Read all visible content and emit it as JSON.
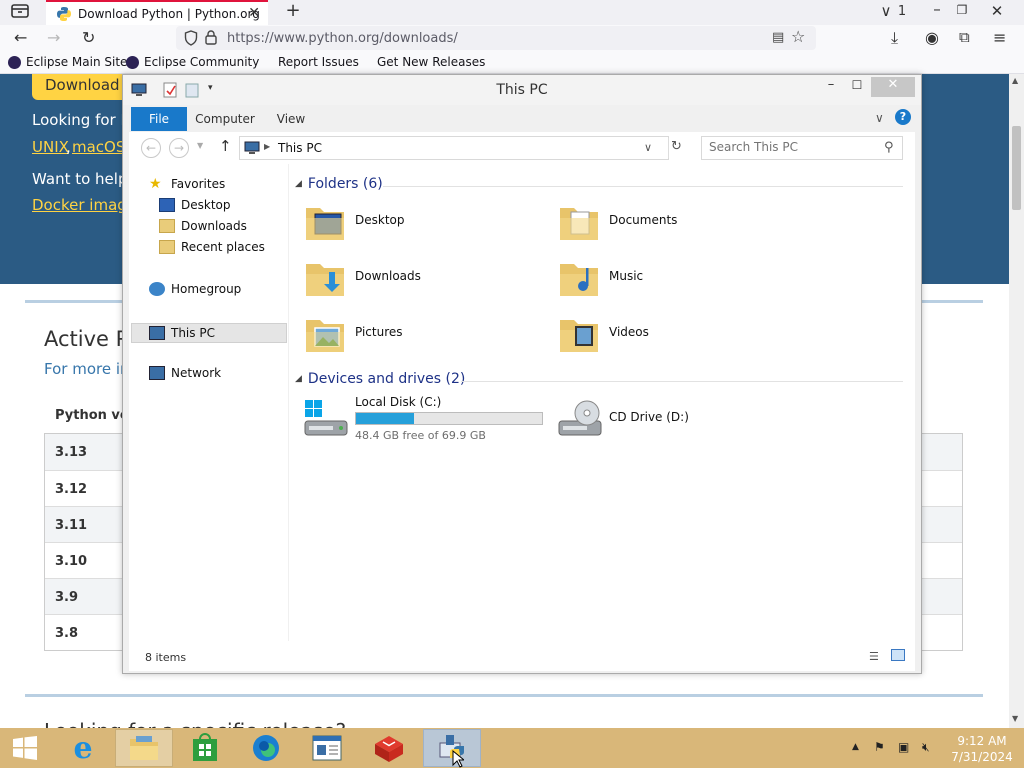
{
  "browser": {
    "tab_title": "Download Python | Python.org",
    "tab_count": "1",
    "url": "https://www.python.org/downloads/",
    "bookmarks": [
      "Eclipse Main Site",
      "Eclipse Community",
      "Report Issues",
      "Get New Releases"
    ]
  },
  "page": {
    "download_button": "Download P",
    "looking_for": "Looking for Py",
    "unix_link": "UNIX",
    "comma": ",",
    "macos_link": "macOS",
    "want_help": "Want to help t",
    "docker_link": "Docker image",
    "active_title": "Active Py",
    "active_sub": "For more inf",
    "version_header": "Python ver",
    "versions": [
      "3.13",
      "3.12",
      "3.11",
      "3.10",
      "3.9",
      "3.8"
    ],
    "next_heading": "Looking for a specific release?"
  },
  "explorer": {
    "title": "This PC",
    "ribbon_tabs": [
      "File",
      "Computer",
      "View"
    ],
    "address": "This PC",
    "search_placeholder": "Search This PC",
    "nav": {
      "favorites": "Favorites",
      "desktop": "Desktop",
      "downloads": "Downloads",
      "recent": "Recent places",
      "homegroup": "Homegroup",
      "thispc": "This PC",
      "network": "Network"
    },
    "folders_header": "Folders (6)",
    "folders": [
      "Desktop",
      "Documents",
      "Downloads",
      "Music",
      "Pictures",
      "Videos"
    ],
    "devices_header": "Devices and drives (2)",
    "drives": {
      "c_name": "Local Disk (C:)",
      "c_free": "48.4 GB free of 69.9 GB",
      "c_used_fraction": 0.31,
      "d_name": "CD Drive (D:)"
    },
    "status": "8 items"
  },
  "taskbar": {
    "time": "9:12 AM",
    "date": "7/31/2024"
  },
  "colors": {
    "accent": "#1979ca",
    "python_blue": "#2b5b84",
    "python_yellow": "#ffd343",
    "taskbar": "#d9b779",
    "drive_fill": "#26a0da"
  }
}
